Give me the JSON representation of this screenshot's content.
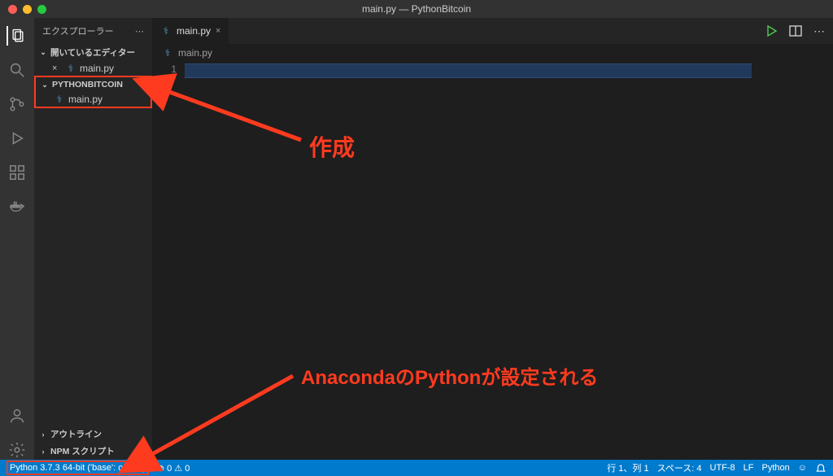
{
  "titlebar": {
    "title": "main.py — PythonBitcoin"
  },
  "sidebar": {
    "title": "エクスプローラー",
    "open_editors_label": "開いているエディター",
    "project_label": "PYTHONBITCOIN",
    "file_label": "main.py",
    "outline_label": "アウトライン",
    "npm_label": "NPM スクリプト"
  },
  "tabs": {
    "main": "main.py"
  },
  "breadcrumb": {
    "file": "main.py"
  },
  "editor": {
    "line_number": "1"
  },
  "statusbar": {
    "python_env": "Python 3.7.3 64-bit ('base': conda)",
    "problems": "⊘ 0 ⚠ 0",
    "cursor": "行 1、列 1",
    "spaces": "スペース: 4",
    "encoding": "UTF-8",
    "eol": "LF",
    "lang": "Python",
    "feedback": "☺"
  },
  "annotations": {
    "create": "作成",
    "anaconda": "AnacondaのPythonが設定される"
  }
}
